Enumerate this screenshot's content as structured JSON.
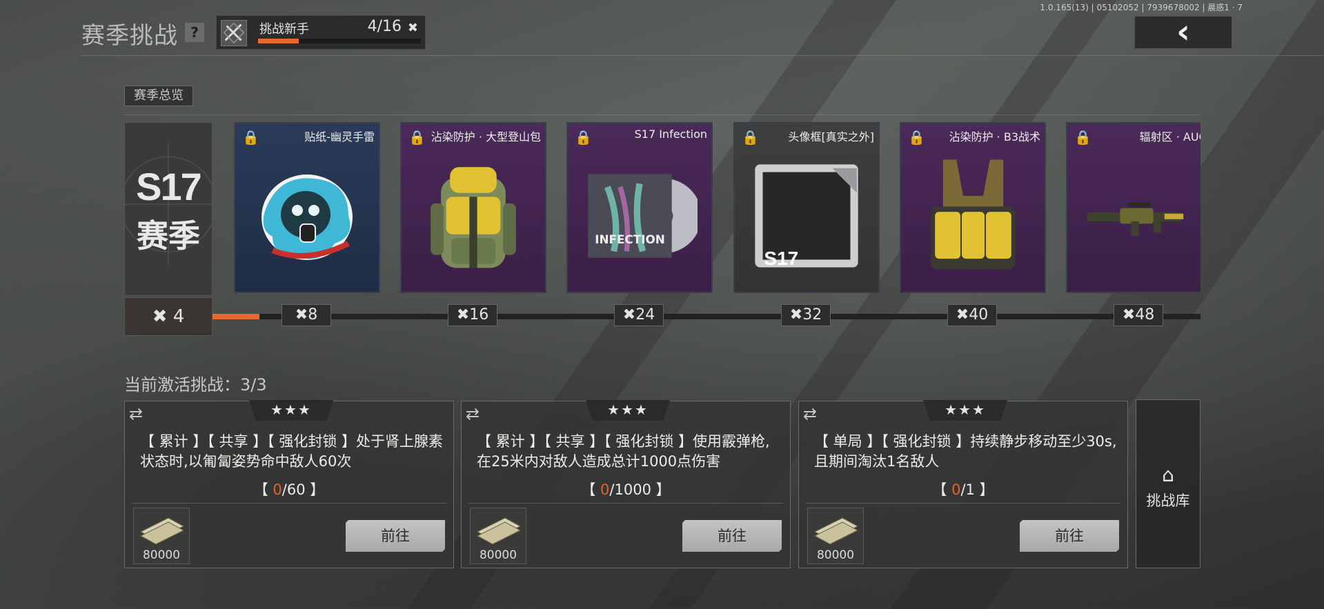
{
  "version": "1.0.165(13) | 05102052 | 7939678002 | 晨惑1 · 7",
  "header": {
    "title": "赛季挑战",
    "help_label": "?",
    "rank_name": "挑战新手",
    "rank_count": "4/16",
    "rank_progress": 0.25,
    "back_icon": "back-arrow-icon"
  },
  "overview": {
    "tab_label": "赛季总览",
    "season_number": "S17",
    "season_label": "赛季",
    "current_tier": "4"
  },
  "rewards": [
    {
      "name": "贴纸-幽灵手雷",
      "tier": "8",
      "rarity": "blue"
    },
    {
      "name": "沾染防护 · 大型登山包",
      "tier": "16",
      "rarity": "purple"
    },
    {
      "name": "S17 Infection",
      "tier": "24",
      "rarity": "purple"
    },
    {
      "name": "头像框[真实之外]",
      "tier": "32",
      "rarity": "gray"
    },
    {
      "name": "沾染防护 · B3战术",
      "tier": "40",
      "rarity": "purple"
    },
    {
      "name": "辐射区 · AUG",
      "tier": "48",
      "rarity": "purple"
    }
  ],
  "album_text": "INFECTION",
  "frame_text": "S17",
  "challenges": {
    "label": "当前激活挑战：3/3",
    "items": [
      {
        "stars": "★★★",
        "desc": "【 累计 】【 共享 】【 强化封锁 】处于肾上腺素状态时,以匍匐姿势命中敌人60次",
        "progress_open": "【 ",
        "current": "0",
        "total": "/60",
        "progress_close": " 】",
        "reward_amount": "80000",
        "go_label": "前往"
      },
      {
        "stars": "★★★",
        "desc": "【 累计 】【 共享 】【 强化封锁 】使用霰弹枪,在25米内对敌人造成总计1000点伤害",
        "progress_open": "【 ",
        "current": "0",
        "total": "/1000",
        "progress_close": " 】",
        "reward_amount": "80000",
        "go_label": "前往"
      },
      {
        "stars": "★★★",
        "desc": "【 单局 】【 强化封锁 】持续静步移动至少30s,且期间淘汰1名敌人",
        "progress_open": "【 ",
        "current": "0",
        "total": "/1",
        "progress_close": " 】",
        "reward_amount": "80000",
        "go_label": "前往"
      }
    ],
    "library_label": "挑战库"
  },
  "colors": {
    "accent": "#e66a30",
    "highlight": "#e6622a"
  }
}
